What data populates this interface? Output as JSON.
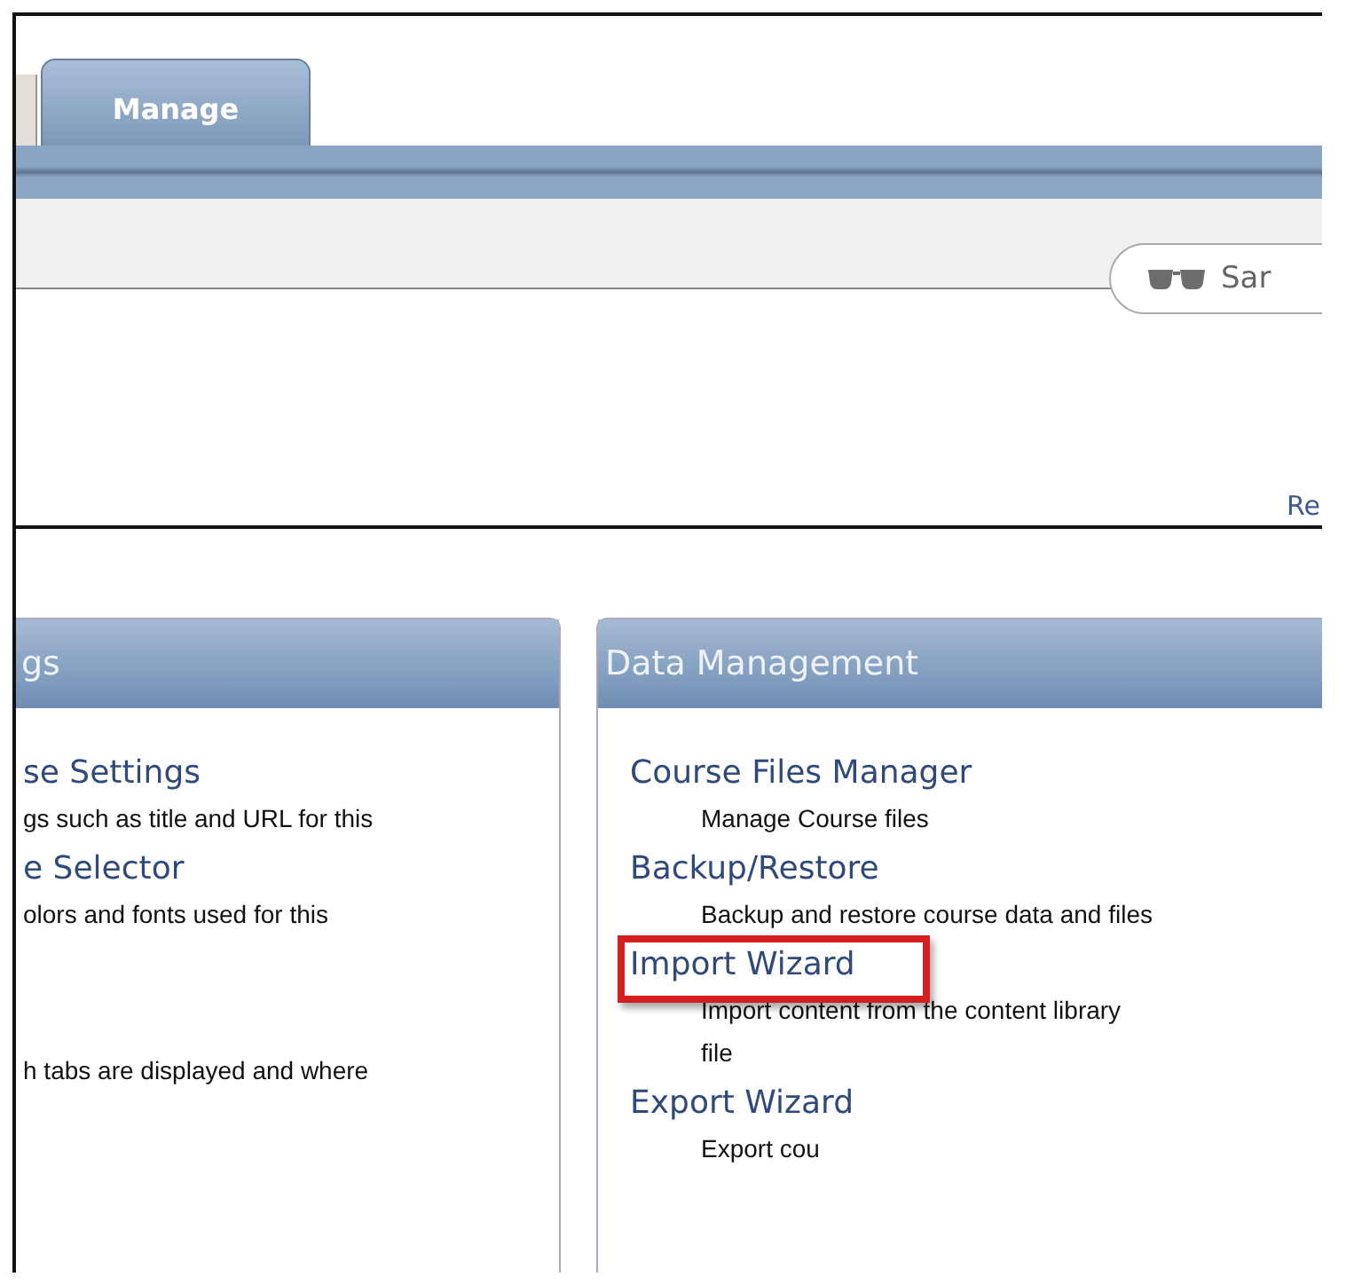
{
  "tabs": [
    {
      "label": "Manage",
      "selected": true
    }
  ],
  "user_pill": {
    "label": "Sar"
  },
  "link_right": "Re",
  "panels": [
    {
      "title": "gs",
      "items": [
        {
          "title": "se Settings",
          "description": [
            "gs such as title and URL for this"
          ]
        },
        {
          "title": "e Selector",
          "description": [
            "olors and fonts used for this"
          ]
        },
        {
          "description": [
            "h tabs are displayed and where"
          ]
        }
      ]
    },
    {
      "title": "Data Management",
      "items": [
        {
          "title": "Course Files Manager",
          "description": [
            "Manage Course files"
          ]
        },
        {
          "title": "Backup/Restore",
          "description": [
            "Backup and restore course data and files"
          ]
        },
        {
          "title": "Import Wizard",
          "highlighted": true,
          "description": [
            "Import content from the content library",
            "file"
          ]
        },
        {
          "title": "Export Wizard",
          "description": [
            "Export cou"
          ]
        }
      ]
    }
  ]
}
